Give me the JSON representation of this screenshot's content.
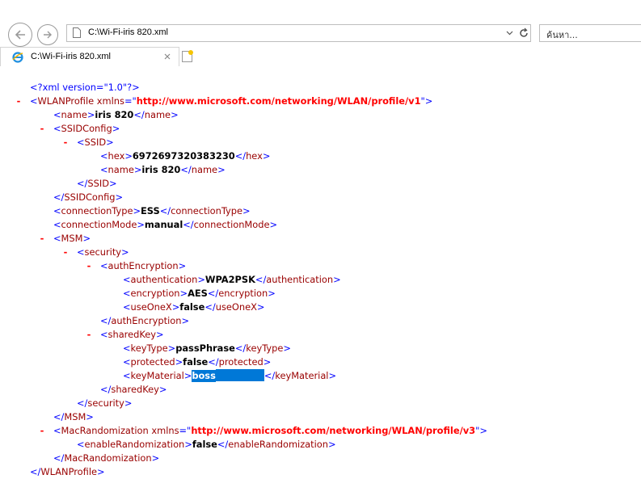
{
  "browser": {
    "address_url": "C:\\Wi-Fi-iris 820.xml",
    "search_placeholder": "ค้นหา...",
    "tab_title": "C:\\Wi-Fi-iris 820.xml"
  },
  "xml": {
    "declaration": "<?xml version=\"1.0\"?>",
    "ns_v1": "http://www.microsoft.com/networking/WLAN/profile/v1",
    "ns_v3": "http://www.microsoft.com/networking/WLAN/profile/v3",
    "toggle": "-",
    "tags": {
      "WLANProfile": "WLANProfile",
      "name": "name",
      "SSIDConfig": "SSIDConfig",
      "SSID": "SSID",
      "hex": "hex",
      "connectionType": "connectionType",
      "connectionMode": "connectionMode",
      "MSM": "MSM",
      "security": "security",
      "authEncryption": "authEncryption",
      "authentication": "authentication",
      "encryption": "encryption",
      "useOneX": "useOneX",
      "sharedKey": "sharedKey",
      "keyType": "keyType",
      "protected": "protected",
      "keyMaterial": "keyMaterial",
      "MacRandomization": "MacRandomization",
      "enableRandomization": "enableRandomization"
    },
    "attr_xmlns": "xmlns",
    "values": {
      "name": "iris 820",
      "hex": "6972697320383230",
      "ssid_name": "iris 820",
      "connectionType": "ESS",
      "connectionMode": "manual",
      "authentication": "WPA2PSK",
      "encryption": "AES",
      "useOneX": "false",
      "keyType": "passPhrase",
      "protected": "false",
      "keyMaterial_visible": "boss",
      "enableRandomization": "false"
    }
  }
}
